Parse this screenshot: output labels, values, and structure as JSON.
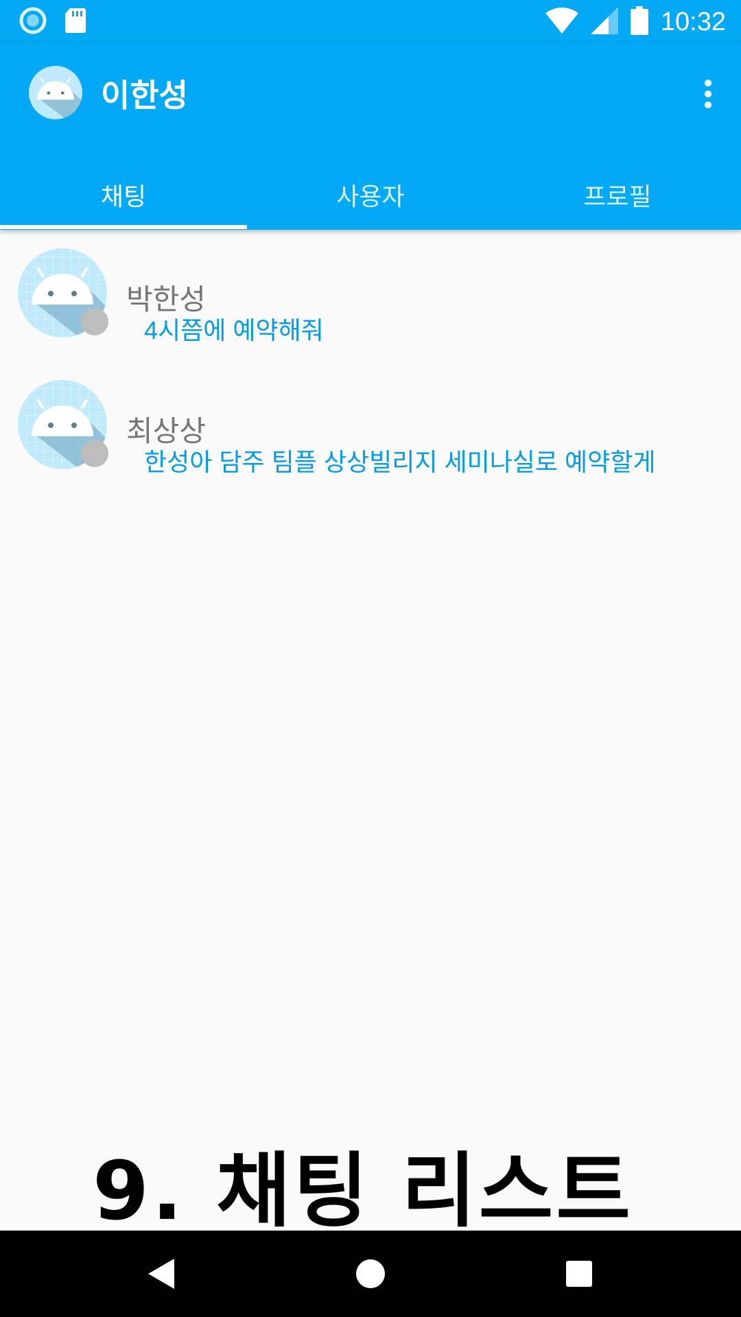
{
  "status_bar": {
    "time": "10:32",
    "icons": [
      "record-icon",
      "sd-card-icon",
      "wifi-icon",
      "signal-icon",
      "battery-icon"
    ]
  },
  "app_bar": {
    "title": "이한성",
    "menu_icon": "more-vert-icon"
  },
  "tabs": [
    {
      "label": "채팅",
      "active": true
    },
    {
      "label": "사용자",
      "active": false
    },
    {
      "label": "프로필",
      "active": false
    }
  ],
  "chats": [
    {
      "name": "박한성",
      "last_message": "4시쯤에 예약해줘"
    },
    {
      "name": "최상상",
      "last_message": "한성아 담주 팀플 상상빌리지 세미나실로 예약할게"
    }
  ],
  "caption": "9. 채팅 리스트",
  "nav_bar": {
    "icons": [
      "back-icon",
      "home-icon",
      "recents-icon"
    ]
  },
  "colors": {
    "primary": "#03a9f4",
    "accent_text": "#039be5",
    "name_text": "#757575",
    "background": "#fafafa",
    "status_dot": "#bdbdbd"
  }
}
